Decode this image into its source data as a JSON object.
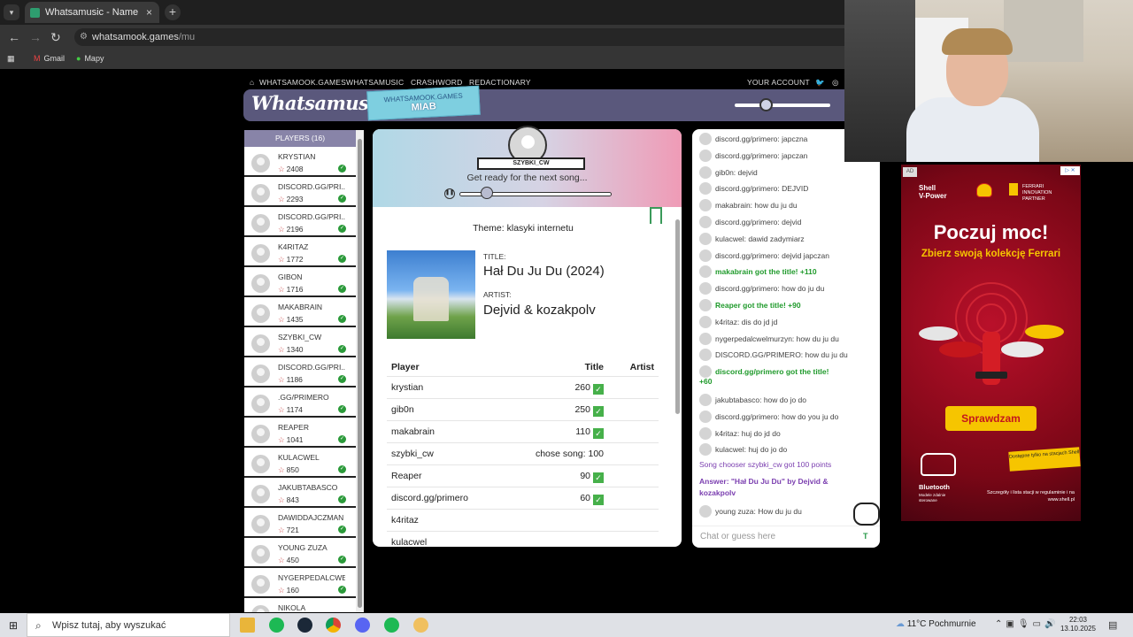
{
  "browser": {
    "tab_title": "Whatsamusic - Name That Tun",
    "tab_close": "×",
    "new_tab": "+",
    "url_domain": "whatsamook.games",
    "url_path": "/mu",
    "bookmarks": [
      {
        "label": "Gmail"
      },
      {
        "label": "Mapy"
      }
    ]
  },
  "site_nav": {
    "items": [
      "WHATSAMOOK.GAMES",
      "WHATSAMUSIC",
      "CRASHWORD",
      "REDACTIONARY"
    ],
    "account": "YOUR ACCOUNT"
  },
  "header": {
    "logo": "Whatsamusic",
    "room_site": "WHATSAMOOK.GAMES",
    "room_name": "MIAB"
  },
  "players": {
    "title": "PLAYERS (16)",
    "list": [
      {
        "name": "KRYSTIAN",
        "score": "2408"
      },
      {
        "name": "DISCORD.GG/PRI...",
        "score": "2293"
      },
      {
        "name": "DISCORD.GG/PRI...",
        "score": "2196"
      },
      {
        "name": "K4RITAZ",
        "score": "1772"
      },
      {
        "name": "GIBON",
        "score": "1716"
      },
      {
        "name": "MAKABRAIN",
        "score": "1435"
      },
      {
        "name": "SZYBKI_CW",
        "score": "1340"
      },
      {
        "name": "DISCORD.GG/PRI...",
        "score": "1186"
      },
      {
        "name": ".GG/PRIMERO",
        "score": "1174"
      },
      {
        "name": "REAPER",
        "score": "1041"
      },
      {
        "name": "KULACWEL",
        "score": "850"
      },
      {
        "name": "JAKUBTABASCO",
        "score": "843"
      },
      {
        "name": "DAWIDDAJCZMAN",
        "score": "721"
      },
      {
        "name": "YOUNG ZUZA",
        "score": "450"
      },
      {
        "name": "NYGERPEDALCWE...",
        "score": "160"
      },
      {
        "name": "NIKOLA",
        "score": ""
      }
    ]
  },
  "round": {
    "chooser": "SZYBKI_CW",
    "status": "Get ready for the next song...",
    "theme": "Theme: klasyki internetu",
    "title_label": "TITLE:",
    "title": "Hał Du Ju Du (2024)",
    "artist_label": "ARTIST:",
    "artist": "Dejvid & kozakpolv"
  },
  "scores": {
    "headers": {
      "player": "Player",
      "title": "Title",
      "artist": "Artist"
    },
    "rows": [
      {
        "player": "krystian",
        "title": "260",
        "check": true
      },
      {
        "player": "gib0n",
        "title": "250",
        "check": true
      },
      {
        "player": "makabrain",
        "title": "110",
        "check": true
      },
      {
        "player": "szybki_cw",
        "title": "chose song: 100",
        "check": false
      },
      {
        "player": "Reaper",
        "title": "90",
        "check": true
      },
      {
        "player": "discord.gg/primero",
        "title": "60",
        "check": true
      },
      {
        "player": "k4ritaz",
        "title": "",
        "check": false
      },
      {
        "player": "kulacwel",
        "title": "",
        "check": false
      }
    ]
  },
  "chat": {
    "messages": [
      {
        "text": "discord.gg/primero: japczna",
        "kind": "msg"
      },
      {
        "text": "discord.gg/primero: japczan",
        "kind": "msg"
      },
      {
        "text": "gib0n: dejvid",
        "kind": "msg"
      },
      {
        "text": "discord.gg/primero: DEJVID",
        "kind": "msg"
      },
      {
        "text": "makabrain: how du ju du",
        "kind": "msg"
      },
      {
        "text": "discord.gg/primero: dejvid",
        "kind": "msg"
      },
      {
        "text": "kulacwel: dawid zadymiarz",
        "kind": "msg"
      },
      {
        "text": "discord.gg/primero: dejvid japczan",
        "kind": "msg"
      },
      {
        "text": "makabrain got the title! +110",
        "kind": "green"
      },
      {
        "text": "discord.gg/primero: how do ju du",
        "kind": "msg"
      },
      {
        "text": "Reaper got the title! +90",
        "kind": "green"
      },
      {
        "text": "k4ritaz: dis do jd jd",
        "kind": "msg"
      },
      {
        "text": "nygerpedalcwelmurzyn: how du ju du",
        "kind": "msg"
      },
      {
        "text": "DISCORD.GG/PRIMERO: how du ju du",
        "kind": "msg"
      },
      {
        "text": "discord.gg/primero got the title!",
        "kind": "green"
      },
      {
        "text": "+60",
        "kind": "green-cont"
      },
      {
        "text": "jakubtabasco: how do jo do",
        "kind": "msg"
      },
      {
        "text": "discord.gg/primero: how do you ju do",
        "kind": "msg"
      },
      {
        "text": "k4ritaz: huj do jd do",
        "kind": "msg"
      },
      {
        "text": "kulacwel: huj do jo do",
        "kind": "msg"
      },
      {
        "text": "Song chooser szybki_cw got 100 points",
        "kind": "purple"
      },
      {
        "text": "Answer: \"Hał Du Ju Du\" by Dejvid &",
        "kind": "purple-bold"
      },
      {
        "text": "kozakpolv",
        "kind": "purple-bold-cont"
      },
      {
        "text": "young zuza: How du ju du",
        "kind": "msg"
      }
    ],
    "input_placeholder": "Chat or guess here",
    "send_label": "T"
  },
  "ad": {
    "tag": "AD",
    "brand_line1": "Shell",
    "brand_line2": "V-Power",
    "partner": "FERRARI INNOVATION PARTNER",
    "headline": "Poczuj moc!",
    "subhead": "Zbierz swoją kolekcję Ferrari",
    "cta": "Sprawdzam",
    "only_at": "Dostępne tylko na stacjach Shell",
    "bt_title": "Bluetooth",
    "bt_sub": "Modele zdalnie sterowane",
    "fine_print": "Szczegóły i lista stacji w regulaminie i na www.shell.pl"
  },
  "taskbar": {
    "search_placeholder": "Wpisz tutaj, aby wyszukać",
    "weather": "11°C Pochmurnie",
    "time": "22:03",
    "date": "13.10.2025"
  }
}
